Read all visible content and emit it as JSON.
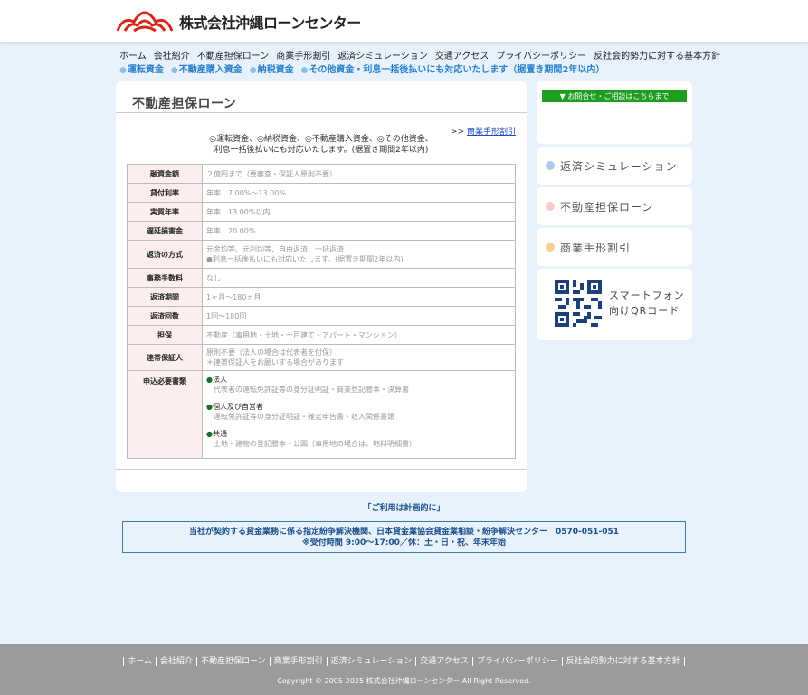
{
  "header": {
    "logo_text": "株式会社沖縄ローンセンター"
  },
  "global_nav": [
    "ホーム",
    "会社紹介",
    "不動産担保ローン",
    "商業手形割引",
    "返済シミュレーション",
    "交通アクセス",
    "プライバシーポリシー",
    "反社会的勢力に対する基本方針"
  ],
  "sub_nav": [
    "運転資金",
    "不動産購入資金",
    "納税資金",
    "その他資金・利息一括後払いにも対応いたします（据置き期間2年以内）"
  ],
  "main": {
    "title": "不動産担保ローン",
    "related_prefix": ">> ",
    "related_link": "商業手形割引",
    "intro_line1": "◎運転資金、◎納税資金、◎不動産購入資金、◎その他資金、",
    "intro_line2": "利息一括後払いにも対応いたします。(据置き期間2年以内)",
    "rows": [
      {
        "label": "融資金額",
        "value": "２億円まで（要審査・保証人原則不要）"
      },
      {
        "label": "貸付利率",
        "value": "年率　7.00%〜13.00%"
      },
      {
        "label": "実質年率",
        "value": "年率　13.00%以内"
      },
      {
        "label": "遅延損害金",
        "value": "年率　20.00%"
      },
      {
        "label": "返済の方式",
        "value": "元金均等、元利均等、自由返済、一括返済",
        "value2": "●利息一括後払いにも対応いたします。(据置き期間2年以内)"
      },
      {
        "label": "事務手数料",
        "value": "なし"
      },
      {
        "label": "返済期間",
        "value": "1ヶ月〜180ヵ月"
      },
      {
        "label": "返済回数",
        "value": "1回〜180回"
      },
      {
        "label": "担保",
        "value": "不動産（事用地・土地・一戸建て・アパート・マンション）"
      },
      {
        "label": "連帯保証人",
        "value": "原則不要（法人の場合は代表者を付保）",
        "value2": "＊連帯保証人をお願いする場合があります"
      }
    ],
    "docs_label": "申込必要書類",
    "docs": [
      {
        "heading": "法人",
        "detail": "代表者の運転免許証等の身分証明証・商業登記謄本・決算書"
      },
      {
        "heading": "個人及び自営者",
        "detail": "運転免許証等の身分証明証・確定申告書・収入関係書類"
      },
      {
        "heading": "共通",
        "detail": "土地・建物の登記謄本・公図（事用地の場合は、地料明細書）"
      }
    ]
  },
  "sidebar": {
    "contact_label": "▼ お問合せ・ご相談はこちらまで",
    "links": [
      {
        "label": "返済シミュレーション",
        "color": "#a9c9ef"
      },
      {
        "label": "不動産担保ローン",
        "color": "#f6cccc"
      },
      {
        "label": "商業手形割引",
        "color": "#f6cf98"
      }
    ],
    "qr_line1": "スマートフォン",
    "qr_line2": "向けQRコード"
  },
  "notice": {
    "plan": "「ご利用は計画的に」",
    "dispute_line1": "当社が契約する貸金業務に係る指定紛争解決機関、日本貸金業協会貸金業相談・紛争解決センター　0570-051-051",
    "dispute_line2": "※受付時間 9:00〜17:00／休：土・日・祝、年末年始"
  },
  "footer": {
    "links": [
      "ホーム",
      "会社紹介",
      "不動産担保ローン",
      "商業手形割引",
      "返済シミュレーション",
      "交通アクセス",
      "プライバシーポリシー",
      "反社会的勢力に対する基本方針"
    ],
    "copyright": "Copyright © 2005-2025 株式会社沖縄ローンセンター All Right Reserved."
  }
}
